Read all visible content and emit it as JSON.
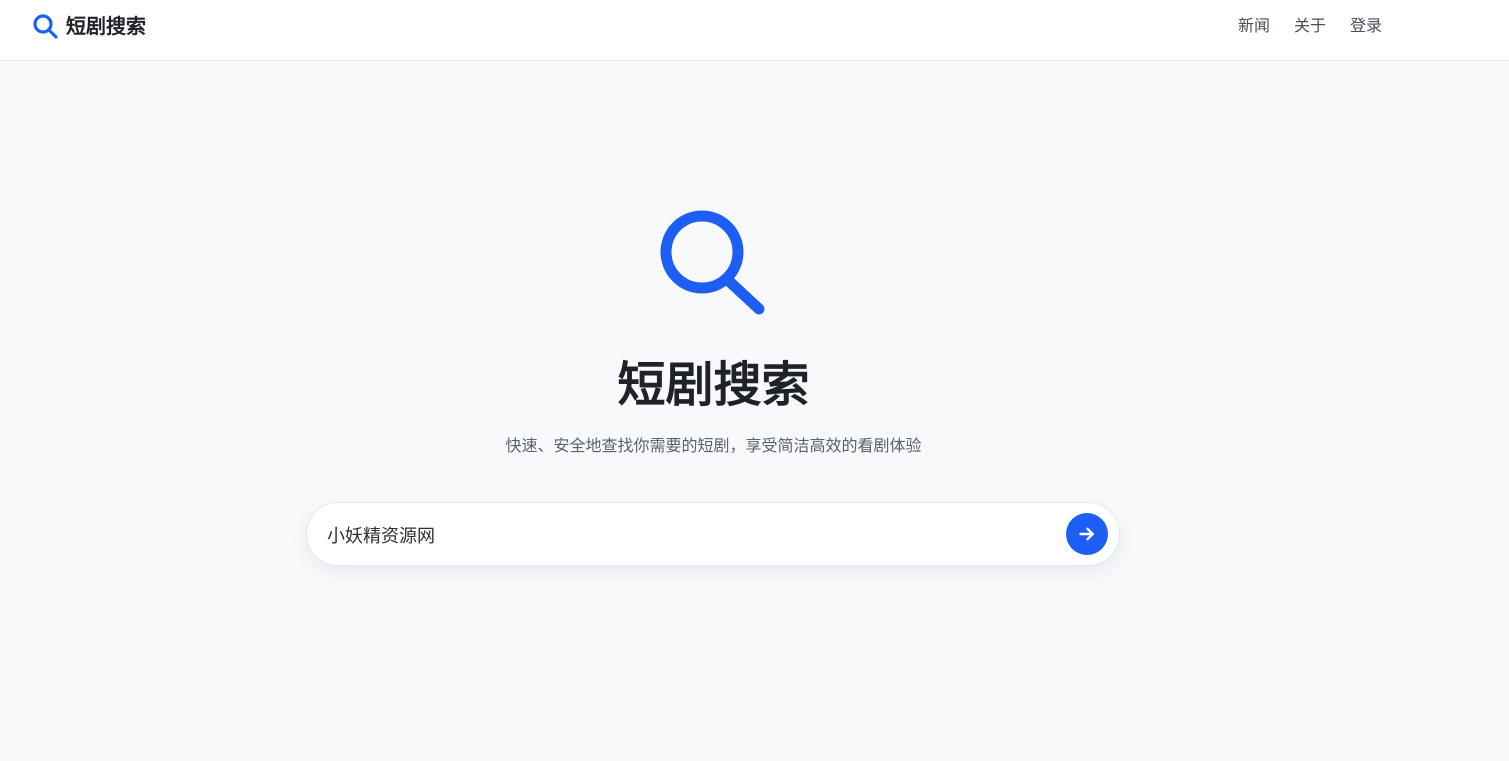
{
  "header": {
    "brand_title": "短剧搜索",
    "nav": [
      {
        "label": "新闻"
      },
      {
        "label": "关于"
      },
      {
        "label": "登录"
      }
    ]
  },
  "hero": {
    "title": "短剧搜索",
    "subtitle": "快速、安全地查找你需要的短剧，享受简洁高效的看剧体验"
  },
  "search": {
    "value": "小妖精资源网",
    "submit_icon": "arrow-right-icon"
  },
  "icons": {
    "brand": "search-icon",
    "hero": "search-icon"
  },
  "colors": {
    "accent": "#1d5ff5",
    "background": "#f8f9fb",
    "header_bg": "#ffffff",
    "text_primary": "#1f2329",
    "text_secondary": "#5b616b"
  }
}
